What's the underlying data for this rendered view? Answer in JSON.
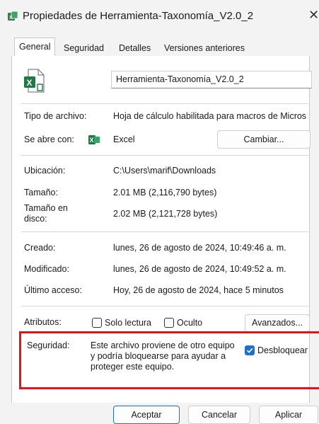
{
  "window": {
    "title": "Propiedades de Herramienta-Taxonomía_V2.0_2",
    "close_glyph": "✕"
  },
  "tabs": [
    {
      "label": "General",
      "active": true
    },
    {
      "label": "Seguridad",
      "active": false
    },
    {
      "label": "Detalles",
      "active": false
    },
    {
      "label": "Versiones anteriores",
      "active": false
    }
  ],
  "file": {
    "name": "Herramienta-Taxonomía_V2.0_2",
    "type_label": "Tipo de archivo:",
    "type_value": "Hoja de cálculo habilitada para macros de Micros",
    "opens_label": "Se abre con:",
    "opens_value": "Excel",
    "change_button": "Cambiar..."
  },
  "location": {
    "location_label": "Ubicación:",
    "location_value": "C:\\Users\\marif\\Downloads",
    "size_label": "Tamaño:",
    "size_value": "2.01 MB (2,116,790 bytes)",
    "disk_label": "Tamaño en disco:",
    "disk_value": "2.02 MB (2,121,728 bytes)"
  },
  "dates": {
    "created_label": "Creado:",
    "created_value": "lunes, 26 de agosto de 2024, 10:49:46 a. m.",
    "modified_label": "Modificado:",
    "modified_value": "lunes, 26 de agosto de 2024, 10:49:52 a. m.",
    "accessed_label": "Último acceso:",
    "accessed_value": "Hoy, 26 de agosto de 2024, hace 5 minutos"
  },
  "attributes": {
    "label": "Atributos:",
    "readonly": "Solo lectura",
    "hidden": "Oculto",
    "advanced_button": "Avanzados..."
  },
  "security": {
    "label": "Seguridad:",
    "message": "Este archivo proviene de otro equipo y podría bloquearse para ayudar a proteger este equipo.",
    "unblock_label": "Desbloquear",
    "unblock_checked": true
  },
  "footer": {
    "accept": "Aceptar",
    "cancel": "Cancelar",
    "apply": "Aplicar"
  },
  "icons": {
    "excel_color": "#1d7a43",
    "highlight_color": "#e3121b",
    "accent_color": "#1f6fd1"
  }
}
